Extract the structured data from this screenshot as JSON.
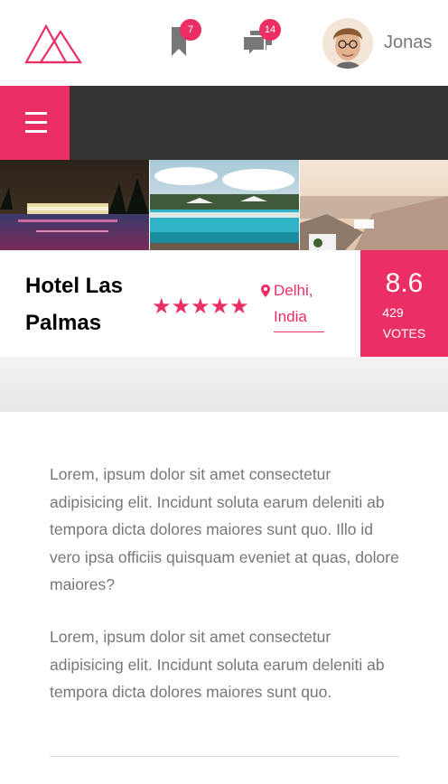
{
  "header": {
    "bookmark_count": "7",
    "message_count": "14",
    "user_name": "Jonas"
  },
  "hotel": {
    "name": "Hotel Las Palmas",
    "stars": 5,
    "stars_text": "★★★★★",
    "location": "Delhi, India",
    "rating_average": "8.6",
    "rating_count": "429",
    "rating_label": "VOTES"
  },
  "description": {
    "paragraph_1": "Lorem, ipsum dolor sit amet consectetur adipisicing elit. Incidunt soluta earum deleniti ab tempora dicta dolores maiores sunt quo. Illo id vero ipsa officiis quisquam eveniet at quas, dolore maiores?",
    "paragraph_2": "Lorem, ipsum dolor sit amet consectetur adipisicing elit. Incidunt soluta earum deleniti ab tempora dicta dolores maiores sunt quo."
  },
  "icons": {
    "logo": "triangle-logo-icon",
    "bookmark": "bookmark-icon",
    "chat": "chat-icon",
    "menu": "hamburger-menu-icon",
    "location": "map-pin-icon",
    "star": "star-icon"
  },
  "colors": {
    "primary": "#eb2f64",
    "nav_background": "#333333",
    "text_grey": "#777777"
  }
}
